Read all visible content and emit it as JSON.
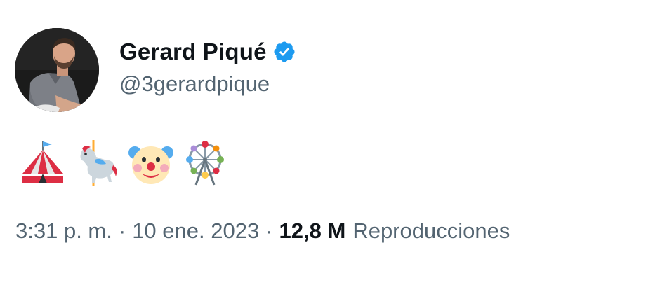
{
  "author": {
    "display_name": "Gerard Piqué",
    "handle": "@3gerardpique",
    "verified": true,
    "verified_color": "#1d9bf0",
    "avatar": "profile-photo"
  },
  "tweet": {
    "emojis": [
      "circus-tent-icon",
      "carousel-horse-icon",
      "clown-face-icon",
      "ferris-wheel-icon"
    ]
  },
  "meta": {
    "time": "3:31 p. m.",
    "separator": "·",
    "date": "10 ene. 2023",
    "views_count": "12,8 M",
    "views_label": "Reproducciones"
  },
  "colors": {
    "text_primary": "#0f1419",
    "text_secondary": "#536471",
    "divider": "#eff3f4"
  }
}
